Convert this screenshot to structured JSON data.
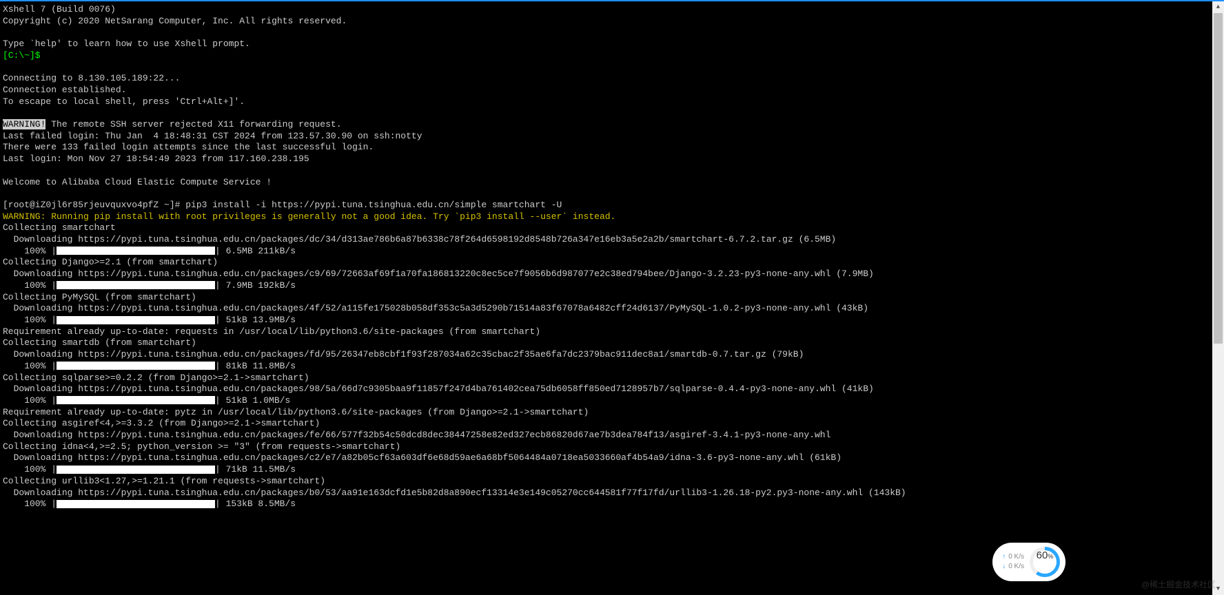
{
  "header": {
    "title": "Xshell 7 (Build 0076)",
    "copyright": "Copyright (c) 2020 NetSarang Computer, Inc. All rights reserved."
  },
  "intro": {
    "help_hint": "Type `help' to learn how to use Xshell prompt.",
    "local_prompt": "[C:\\~]$"
  },
  "conn": {
    "connecting": "Connecting to 8.130.105.189:22...",
    "established": "Connection established.",
    "escape_hint": "To escape to local shell, press 'Ctrl+Alt+]'."
  },
  "warning_tag": "WARNING!",
  "x11_reject": " The remote SSH server rejected X11 forwarding request.",
  "login": {
    "last_failed": "Last failed login: Thu Jan  4 18:48:31 CST 2024 from 123.57.30.90 on ssh:notty",
    "failed_attempts": "There were 133 failed login attempts since the last successful login.",
    "last_login": "Last login: Mon Nov 27 18:54:49 2023 from 117.160.238.195"
  },
  "welcome": "Welcome to Alibaba Cloud Elastic Compute Service !",
  "remote_prompt": "[root@iZ0jl6r85rjeuvquxvo4pfZ ~]# ",
  "command": "pip3 install -i https://pypi.tuna.tsinghua.edu.cn/simple smartchart -U",
  "pip_root_warning": "WARNING: Running pip install with root privileges is generally not a good idea. Try `pip3 install --user` instead.",
  "lines": {
    "l1": "Collecting smartchart",
    "l2": "  Downloading https://pypi.tuna.tsinghua.edu.cn/packages/dc/34/d313ae786b6a87b6338c78f264d6598192d8548b726a347e16eb3a5e2a2b/smartchart-6.7.2.tar.gz (6.5MB)",
    "p1a": "    100% |",
    "p1b": "| 6.5MB 211kB/s ",
    "l3": "Collecting Django>=2.1 (from smartchart)",
    "l4": "  Downloading https://pypi.tuna.tsinghua.edu.cn/packages/c9/69/72663af69f1a70fa186813220c8ec5ce7f9056b6d987077e2c38ed794bee/Django-3.2.23-py3-none-any.whl (7.9MB)",
    "p2a": "    100% |",
    "p2b": "| 7.9MB 192kB/s ",
    "l5": "Collecting PyMySQL (from smartchart)",
    "l6": "  Downloading https://pypi.tuna.tsinghua.edu.cn/packages/4f/52/a115fe175028b058df353c5a3d5290b71514a83f67078a6482cff24d6137/PyMySQL-1.0.2-py3-none-any.whl (43kB)",
    "p3a": "    100% |",
    "p3b": "| 51kB 13.9MB/s ",
    "l7": "Requirement already up-to-date: requests in /usr/local/lib/python3.6/site-packages (from smartchart)",
    "l8": "Collecting smartdb (from smartchart)",
    "l9": "  Downloading https://pypi.tuna.tsinghua.edu.cn/packages/fd/95/26347eb8cbf1f93f287034a62c35cbac2f35ae6fa7dc2379bac911dec8a1/smartdb-0.7.tar.gz (79kB)",
    "p4a": "    100% |",
    "p4b": "| 81kB 11.8MB/s ",
    "l10": "Collecting sqlparse>=0.2.2 (from Django>=2.1->smartchart)",
    "l11": "  Downloading https://pypi.tuna.tsinghua.edu.cn/packages/98/5a/66d7c9305baa9f11857f247d4ba761402cea75db6058ff850ed7128957b7/sqlparse-0.4.4-py3-none-any.whl (41kB)",
    "p5a": "    100% |",
    "p5b": "| 51kB 1.0MB/s ",
    "l12": "Requirement already up-to-date: pytz in /usr/local/lib/python3.6/site-packages (from Django>=2.1->smartchart)",
    "l13": "Collecting asgiref<4,>=3.3.2 (from Django>=2.1->smartchart)",
    "l14": "  Downloading https://pypi.tuna.tsinghua.edu.cn/packages/fe/66/577f32b54c50dcd8dec38447258e82ed327ecb86820d67ae7b3dea784f13/asgiref-3.4.1-py3-none-any.whl",
    "l15": "Collecting idna<4,>=2.5; python_version >= \"3\" (from requests->smartchart)",
    "l16": "  Downloading https://pypi.tuna.tsinghua.edu.cn/packages/c2/e7/a82b05cf63a603df6e68d59ae6a68bf5064484a0718ea5033660af4b54a9/idna-3.6-py3-none-any.whl (61kB)",
    "p6a": "    100% |",
    "p6b": "| 71kB 11.5MB/s ",
    "l17": "Collecting urllib3<1.27,>=1.21.1 (from requests->smartchart)",
    "l18": "  Downloading https://pypi.tuna.tsinghua.edu.cn/packages/b0/53/aa91e163dcfd1e5b82d8a890ecf13314e3e149c05270cc644581f77f17fd/urllib3-1.26.18-py2.py3-none-any.whl (143kB)",
    "p7a": "    100% |",
    "p7b": "| 153kB 8.5MB/s "
  },
  "widget": {
    "up": "0  K/s",
    "down": "0  K/s",
    "percent_num": "60",
    "percent_sym": "%"
  },
  "watermark": "@稀土掘金技术社区"
}
